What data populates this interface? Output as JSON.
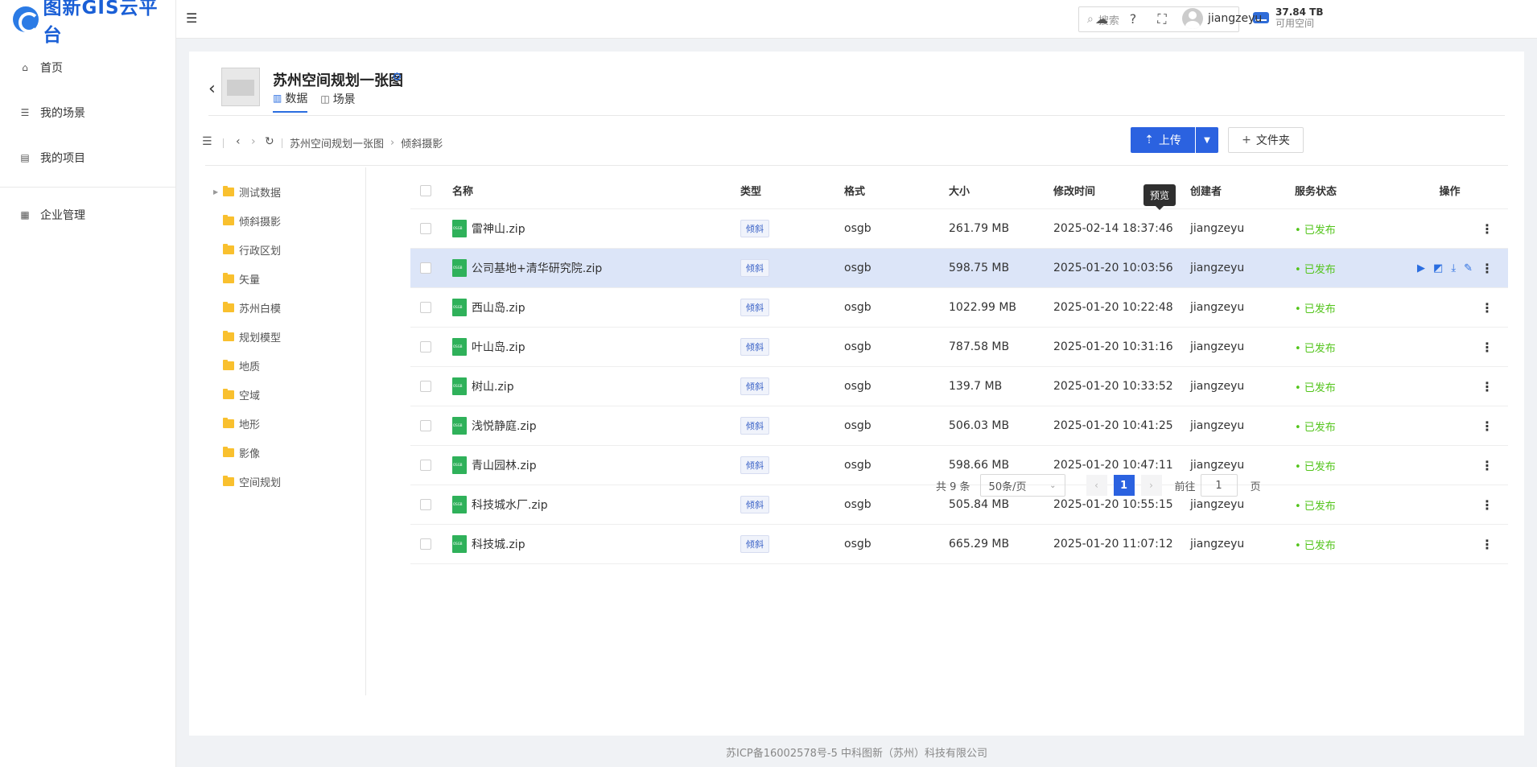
{
  "app": {
    "logo_text": "图新GIS云平台"
  },
  "sidebar": {
    "items": [
      {
        "label": "首页",
        "icon": "home-icon"
      },
      {
        "label": "我的场景",
        "icon": "list-icon"
      },
      {
        "label": "我的项目",
        "icon": "project-icon"
      },
      {
        "label": "企业管理",
        "icon": "building-icon"
      }
    ]
  },
  "header": {
    "search_placeholder": "搜索",
    "storage_value": "37.84 TB",
    "storage_label": "可用空间",
    "username": "jiangzeyu"
  },
  "project": {
    "title": "苏州空间规划一张图",
    "tabs": [
      {
        "label": "数据"
      },
      {
        "label": "场景"
      }
    ]
  },
  "toolbar": {
    "breadcrumb": [
      "苏州空间规划一张图",
      "倾斜摄影"
    ],
    "upload_label": "上传",
    "folder_label": "文件夹"
  },
  "tree": [
    {
      "label": "测试数据",
      "expandable": true
    },
    {
      "label": "倾斜摄影"
    },
    {
      "label": "行政区划"
    },
    {
      "label": "矢量"
    },
    {
      "label": "苏州白模"
    },
    {
      "label": "规划模型"
    },
    {
      "label": "地质"
    },
    {
      "label": "空域"
    },
    {
      "label": "地形"
    },
    {
      "label": "影像"
    },
    {
      "label": "空间规划"
    }
  ],
  "table": {
    "headers": [
      "名称",
      "类型",
      "格式",
      "大小",
      "修改时间",
      "创建者",
      "服务状态",
      "操作"
    ],
    "rows": [
      {
        "name": "雷神山.zip",
        "type": "倾斜",
        "format": "osgb",
        "size": "261.79 MB",
        "time": "2025-02-14 18:37:46",
        "creator": "jiangzeyu",
        "status": "• 已发布"
      },
      {
        "name": "公司基地+清华研究院.zip",
        "type": "倾斜",
        "format": "osgb",
        "size": "598.75 MB",
        "time": "2025-01-20 10:03:56",
        "creator": "jiangzeyu",
        "status": "• 已发布"
      },
      {
        "name": "西山岛.zip",
        "type": "倾斜",
        "format": "osgb",
        "size": "1022.99 MB",
        "time": "2025-01-20 10:22:48",
        "creator": "jiangzeyu",
        "status": "• 已发布"
      },
      {
        "name": "叶山岛.zip",
        "type": "倾斜",
        "format": "osgb",
        "size": "787.58 MB",
        "time": "2025-01-20 10:31:16",
        "creator": "jiangzeyu",
        "status": "• 已发布"
      },
      {
        "name": "树山.zip",
        "type": "倾斜",
        "format": "osgb",
        "size": "139.7 MB",
        "time": "2025-01-20 10:33:52",
        "creator": "jiangzeyu",
        "status": "• 已发布"
      },
      {
        "name": "浅悦静庭.zip",
        "type": "倾斜",
        "format": "osgb",
        "size": "506.03 MB",
        "time": "2025-01-20 10:41:25",
        "creator": "jiangzeyu",
        "status": "• 已发布"
      },
      {
        "name": "青山园林.zip",
        "type": "倾斜",
        "format": "osgb",
        "size": "598.66 MB",
        "time": "2025-01-20 10:47:11",
        "creator": "jiangzeyu",
        "status": "• 已发布"
      },
      {
        "name": "科技城水厂.zip",
        "type": "倾斜",
        "format": "osgb",
        "size": "505.84 MB",
        "time": "2025-01-20 10:55:15",
        "creator": "jiangzeyu",
        "status": "• 已发布"
      },
      {
        "name": "科技城.zip",
        "type": "倾斜",
        "format": "osgb",
        "size": "665.29 MB",
        "time": "2025-01-20 11:07:12",
        "creator": "jiangzeyu",
        "status": "• 已发布"
      }
    ],
    "tooltip": "预览"
  },
  "pager": {
    "total": "共 9 条",
    "page_size": "50条/页",
    "current": "1",
    "goto_label": "前往",
    "goto_value": "1",
    "page_suffix": "页"
  },
  "footer": {
    "text": "苏ICP备16002578号-5 中科图新（苏州）科技有限公司"
  }
}
